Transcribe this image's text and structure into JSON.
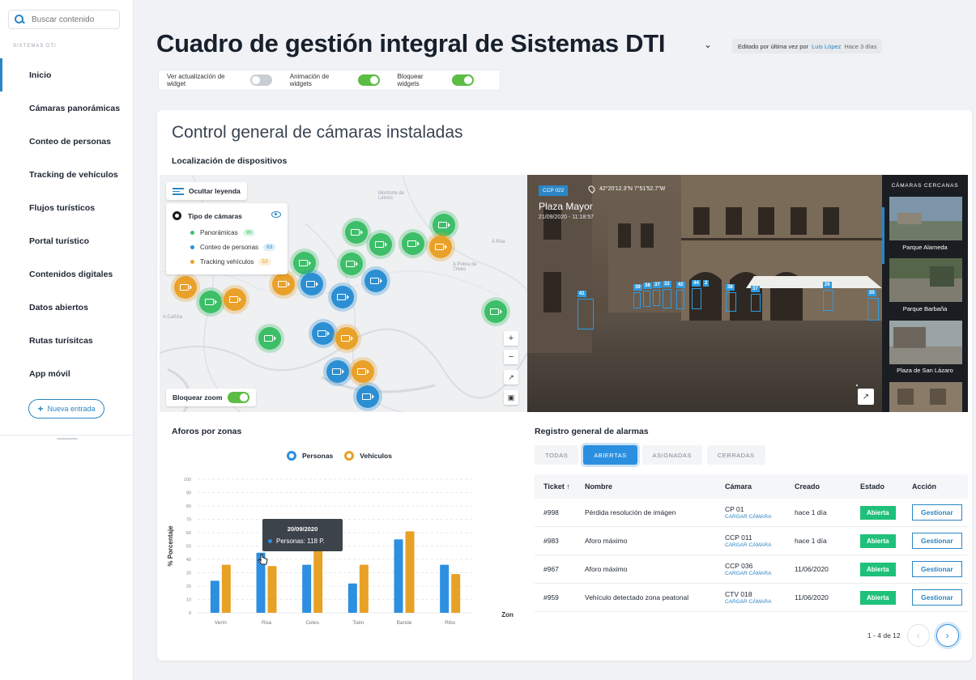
{
  "search": {
    "placeholder": "Buscar contenido"
  },
  "sidebar": {
    "section": "SISTEMAS DTI",
    "items": [
      {
        "label": "Inicio"
      },
      {
        "label": "Cámaras panorámicas"
      },
      {
        "label": "Conteo de personas"
      },
      {
        "label": "Tracking de vehículos"
      },
      {
        "label": "Flujos turísticos"
      },
      {
        "label": "Portal turístico"
      },
      {
        "label": "Contenidos digitales"
      },
      {
        "label": "Datos abiertos"
      },
      {
        "label": "Rutas turísitcas"
      },
      {
        "label": "App móvil"
      }
    ],
    "new_entry": "Nueva entrada"
  },
  "header": {
    "title": "Cuadro de gestión integral de Sistemas DTI",
    "edited_prefix": "Editado por última vez por",
    "edited_user": "Luis López",
    "edited_ago": "Hace 3 días",
    "toggles": [
      {
        "label": "Ver actualización de widget",
        "on": false
      },
      {
        "label": "Animación de widgets",
        "on": true
      },
      {
        "label": "Bloquear widgets",
        "on": true
      }
    ]
  },
  "card": {
    "title": "Control general de cámaras instaladas",
    "subtitle": "Localización de dispositivos"
  },
  "map": {
    "hide_legend": "Ocultar leyenda",
    "legend_title": "Tipo de cámaras",
    "legend": [
      {
        "label": "Panorámicas",
        "count": "99",
        "color": "#3dbe68"
      },
      {
        "label": "Conteo de personas",
        "count": "63",
        "color": "#2c8fd3"
      },
      {
        "label": "Tracking vehículos",
        "count": "53",
        "color": "#e9a12a"
      }
    ],
    "place_labels": [
      "Monforte de Lemos",
      "A Rúa",
      "A Pobra de Trives",
      "A Cañiza"
    ],
    "lock_zoom": "Bloquear zoom",
    "lock_zoom_on": true
  },
  "camera": {
    "id": "CCP 022",
    "coords": "42°20'12.3\"N 7°51'52.7\"W",
    "place": "Plaza Mayor",
    "datetime": "21/09/2020 - 11:18:57",
    "detections": [
      "41",
      "39",
      "38",
      "37",
      "32",
      "42",
      "44",
      "2",
      "38",
      "37",
      "26",
      "35"
    ]
  },
  "nearby": {
    "title": "CÁMARAS CERCANAS",
    "items": [
      {
        "label": "Parque Alameda"
      },
      {
        "label": "Parque Barbaña"
      },
      {
        "label": "Plaza de San Lázaro"
      }
    ]
  },
  "aforos": {
    "title": "Aforos por zonas",
    "tooltip_date": "20/09/2020",
    "tooltip_value": "Personas: 118 P."
  },
  "chart_data": {
    "type": "bar",
    "categories": [
      "Verín",
      "Rúa",
      "Celes",
      "Toén",
      "Bande",
      "Ribs"
    ],
    "series": [
      {
        "name": "Personas",
        "color": "#2e8fe0",
        "values": [
          24,
          45,
          36,
          22,
          55,
          36
        ]
      },
      {
        "name": "Vehículos",
        "color": "#e8a127",
        "values": [
          36,
          35,
          49,
          36,
          61,
          29
        ]
      }
    ],
    "ylabel": "% Porcentaje",
    "xlabel": "Zonas",
    "ylim": [
      0,
      100
    ],
    "yticks": [
      0,
      10,
      20,
      30,
      40,
      50,
      60,
      70,
      80,
      90,
      100
    ],
    "grid": true,
    "legend": "top-center"
  },
  "alarms": {
    "title": "Registro general de alarmas",
    "tabs": [
      "TODAS",
      "ABIERTAS",
      "ASIGNADAS",
      "CERRADAS"
    ],
    "active_tab": "ABIERTAS",
    "columns": [
      "Ticket",
      "Nombre",
      "Cámara",
      "Creado",
      "Estado",
      "Acción"
    ],
    "rows": [
      {
        "ticket": "#998",
        "name": "Pérdida resolución de imágen",
        "camera": "CP 01",
        "load": "CARGAR CÁMARA",
        "created": "hace 1 día",
        "status": "Abierta",
        "action": "Gestionar"
      },
      {
        "ticket": "#983",
        "name": "Aforo máximo",
        "camera": "CCP 011",
        "load": "CARGAR CÁMARA",
        "created": "hace 1 día",
        "status": "Abierta",
        "action": "Gestionar"
      },
      {
        "ticket": "#967",
        "name": "Aforo máximo",
        "camera": "CCP 036",
        "load": "CARGAR CÁMARA",
        "created": "11/06/2020",
        "status": "Abierta",
        "action": "Gestionar"
      },
      {
        "ticket": "#959",
        "name": "Vehículo detectado zona peatonal",
        "camera": "CTV 018",
        "load": "CARGAR CÁMARA",
        "created": "11/06/2020",
        "status": "Abierta",
        "action": "Gestionar"
      }
    ],
    "pagination": "1 - 4 de 12"
  }
}
